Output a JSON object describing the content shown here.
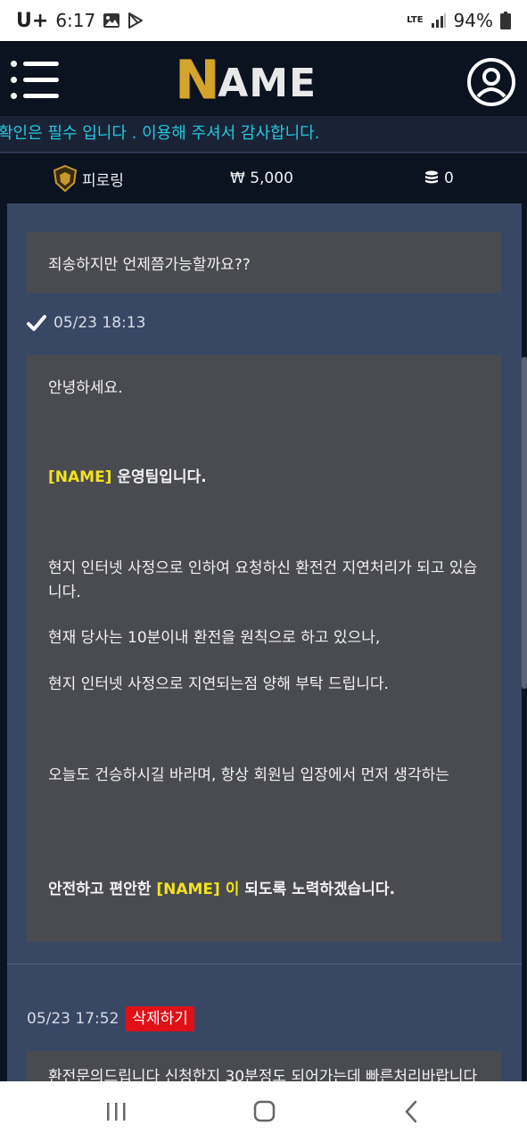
{
  "status_bar": {
    "carrier": "U+",
    "time": "6:17",
    "network": "LTE",
    "battery": "94%"
  },
  "header": {
    "logo_n": "N",
    "logo_rest": "AME"
  },
  "ticker": {
    "text": "확인은 필수 입니다 . 이용해 주셔서 감사합니다."
  },
  "wallet": {
    "level": "피로링",
    "money": "₩ 5,000",
    "point": "0"
  },
  "messages": {
    "msg1": "죄송하지만 언제쯤가능할까요??",
    "answer_time": "05/23 18:13",
    "answer": {
      "greeting": "안녕하세요.",
      "team_name": "[NAME]",
      "team_suffix": " 운영팀입니다.",
      "line1": "현지 인터넷 사정으로 인하여 요청하신 환전건 지연처리가 되고 있습니다.",
      "line2": "현재 당사는 10분이내 환전을 원칙으로 하고 있으나,",
      "line3": "현지 인터넷 사정으로 지연되는점 양해 부탁 드립니다.",
      "line4": "오늘도 건승하시길 바라며, 항상 회원님 입장에서 먼저 생각하는",
      "closing_prefix": "안전하고 편안한 ",
      "closing_name": "[NAME] 이",
      "closing_suffix": " 되도록 노력하겠습니다."
    },
    "question_time": "05/23 17:52",
    "delete_label": "삭제하기",
    "msg3": "환전문의드립니다 신청한지 30분정도 되어가는데 빠른처리바랍니다"
  }
}
